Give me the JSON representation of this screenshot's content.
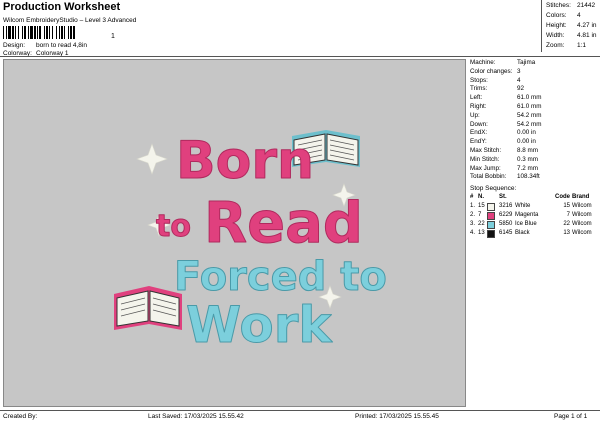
{
  "header": {
    "title": "Production Worksheet",
    "subtitle": "Wilcom EmbroideryStudio – Level 3 Advanced",
    "barcode_suffix": "1",
    "design_label": "Design:",
    "design_value": "born to read 4,8in",
    "colorway_label": "Colorway:",
    "colorway_value": "Colorway 1"
  },
  "top_stats": [
    {
      "label": "Stitches:",
      "value": "21442"
    },
    {
      "label": "Colors:",
      "value": "4"
    },
    {
      "label": "Height:",
      "value": "4.27 in"
    },
    {
      "label": "Width:",
      "value": "4.81 in"
    },
    {
      "label": "Zoom:",
      "value": "1:1"
    }
  ],
  "design_text": {
    "line1": "Born",
    "line2a": "to",
    "line2b": "Read",
    "line3": "Forced to",
    "line4": "Work"
  },
  "info": [
    {
      "label": "Machine:",
      "value": "Tajima"
    },
    {
      "label": "Color changes:",
      "value": "3"
    },
    {
      "label": "Stops:",
      "value": "4"
    },
    {
      "label": "Trims:",
      "value": "92"
    },
    {
      "label": "Left:",
      "value": "61.0 mm"
    },
    {
      "label": "Right:",
      "value": "61.0 mm"
    },
    {
      "label": "Up:",
      "value": "54.2 mm"
    },
    {
      "label": "Down:",
      "value": "54.2 mm"
    },
    {
      "label": "EndX:",
      "value": "0.00 in"
    },
    {
      "label": "EndY:",
      "value": "0.00 in"
    },
    {
      "label": "Max Stitch:",
      "value": "8.8 mm"
    },
    {
      "label": "Min Stitch:",
      "value": "0.3 mm"
    },
    {
      "label": "Max Jump:",
      "value": "7.2 mm"
    },
    {
      "label": "Total Bobbin:",
      "value": "108.34ft"
    }
  ],
  "stop_sequence": {
    "title": "Stop Sequence:",
    "headers": {
      "num": "#",
      "n": "N.",
      "st": "St.",
      "code": "Code",
      "brand": "Brand"
    },
    "rows": [
      {
        "num": "1.",
        "n": "15",
        "st": "3216",
        "color_name": "White",
        "swatch": "#f4f4ec",
        "code": "15",
        "brand": "Wilcom"
      },
      {
        "num": "2.",
        "n": "7",
        "st": "6229",
        "color_name": "Magenta",
        "swatch": "#e0407e",
        "code": "7",
        "brand": "Wilcom"
      },
      {
        "num": "3.",
        "n": "22",
        "st": "5850",
        "color_name": "Ice Blue",
        "swatch": "#7ccfdc",
        "code": "22",
        "brand": "Wilcom"
      },
      {
        "num": "4.",
        "n": "13",
        "st": "6145",
        "color_name": "Black",
        "swatch": "#111111",
        "code": "13",
        "brand": "Wilcom"
      }
    ]
  },
  "footer": {
    "created_by": "Created By:",
    "last_saved": "Last Saved: 17/03/2025 15.55.42",
    "printed": "Printed: 17/03/2025 15.55.45",
    "page": "Page 1 of 1"
  },
  "colors": {
    "magenta": "#e0407e",
    "ice_blue": "#7ccfdc",
    "cream": "#f4f4ec",
    "background": "#c6c6c6"
  }
}
